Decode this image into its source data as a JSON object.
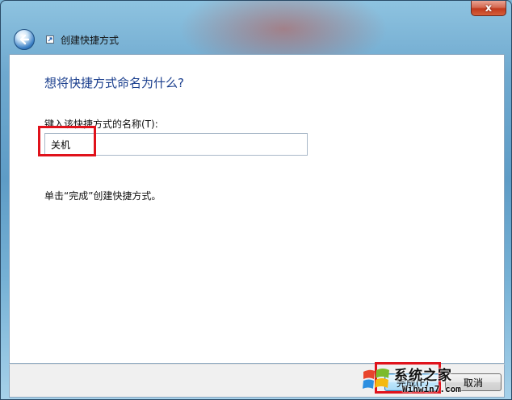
{
  "window": {
    "close_label": "x",
    "wizard_title": "创建快捷方式"
  },
  "page": {
    "heading": "想将快捷方式命名为什么?",
    "field_label": "键入该快捷方式的名称(T):",
    "name_value": "关机",
    "hint": "单击“完成”创建快捷方式。"
  },
  "footer": {
    "finish_label": "完成(F)",
    "cancel_label": "取消"
  },
  "watermark": {
    "site_name": "系统之家",
    "url": "Winwin7.com"
  },
  "icons": {
    "back": "back-arrow-icon",
    "shortcut": "shortcut-icon",
    "windows_logo": "windows-logo-icon"
  },
  "colors": {
    "heading": "#1b3f8e",
    "highlight": "#e0121b",
    "close_button": "#c23a1e"
  }
}
